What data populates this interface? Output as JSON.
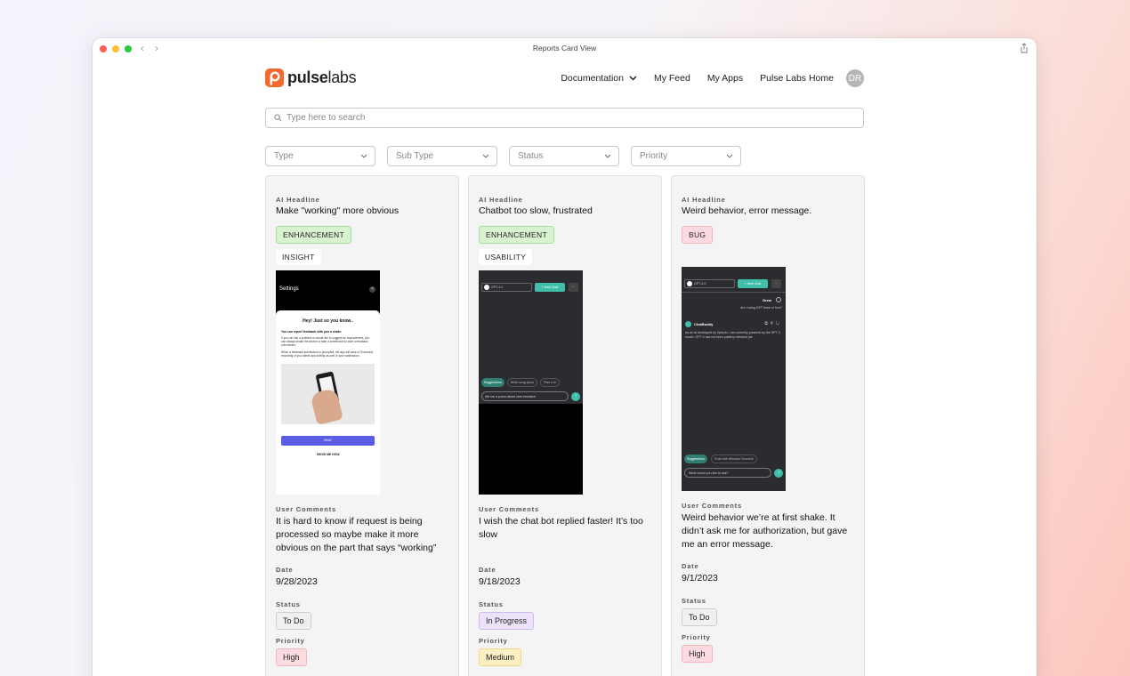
{
  "window": {
    "title": "Reports Card View"
  },
  "header": {
    "logo": {
      "bold": "pulse",
      "light": "labs"
    },
    "nav": [
      {
        "label": "Documentation"
      },
      {
        "label": "My Feed"
      },
      {
        "label": "My Apps"
      },
      {
        "label": "Pulse Labs Home"
      }
    ],
    "avatar_initials": "DR"
  },
  "search": {
    "placeholder": "Type here to search"
  },
  "filters": [
    "Type",
    "Sub Type",
    "Status",
    "Priority"
  ],
  "labels": {
    "ai_headline": "AI Headline",
    "user_comments": "User Comments",
    "date": "Date",
    "status": "Status",
    "priority": "Priority"
  },
  "cards": [
    {
      "headline": "Make \"working\" more obvious",
      "type": "ENHANCEMENT",
      "subtype": "INSIGHT",
      "screenshot": {
        "settings": "Settings",
        "modal_title": "Hey! Just so you know..",
        "modal_bold": "You can report feedback with just a shake",
        "modal_p1": "If you run into a problem or would like to suggest an improvement, you can always shake the device or take a screenshot to start a feedback submission.",
        "modal_p2": "When a feedback submission is prompted, the app will save a 15-second recording of your latest app activity as part of your submission.",
        "okay": "OKAY",
        "show": "SHOW ME HOW"
      },
      "comments": "It is hard to know if request is being processed so maybe make it more obvious on the part that says “working”",
      "date": "9/28/2023",
      "status": "To Do",
      "priority": "High"
    },
    {
      "headline": "Chatbot too slow, frustrated",
      "type": "ENHANCEMENT",
      "subtype": "USABILITY",
      "screenshot": {
        "model": "GPT-4.0",
        "new_chat": "+ New Chat",
        "chips": [
          "Suggestions",
          "Write song lyrics",
          "Plan a tri"
        ],
        "input": "rite me a poem about user research"
      },
      "comments": "I wish the chat bot replied faster! It’s too slow",
      "date": "9/18/2023",
      "status": "In Progress",
      "priority": "Medium"
    },
    {
      "headline": "Weird behavior, error message.",
      "type": "BUG",
      "subtype": "",
      "screenshot": {
        "model": "GPT-4.0",
        "new_chat": "+ New Chat",
        "user_name": "Drew",
        "user_msg": "Are I using GPT three or four?",
        "bot_name": "ChatBuddy",
        "bot_msg": "As an AI developed by OpenAI, I am currently powered by the GPT-3 model. GPT-4 has not been publicly released yet.",
        "chips": [
          "Suggestions",
          "Chat with Winston Churchill"
        ],
        "input": "What would you like to ask?"
      },
      "comments": "Weird behavior we’re at first shake. It didn’t ask me for authorization, but gave me an error message.",
      "date": "9/1/2023",
      "status": "To Do",
      "priority": "High"
    }
  ],
  "colors": {
    "brand": "#f26a2e",
    "chat_bg": "#2b2c30",
    "accent_teal": "#3fbfa9",
    "okay_button": "#5b5ce6"
  }
}
